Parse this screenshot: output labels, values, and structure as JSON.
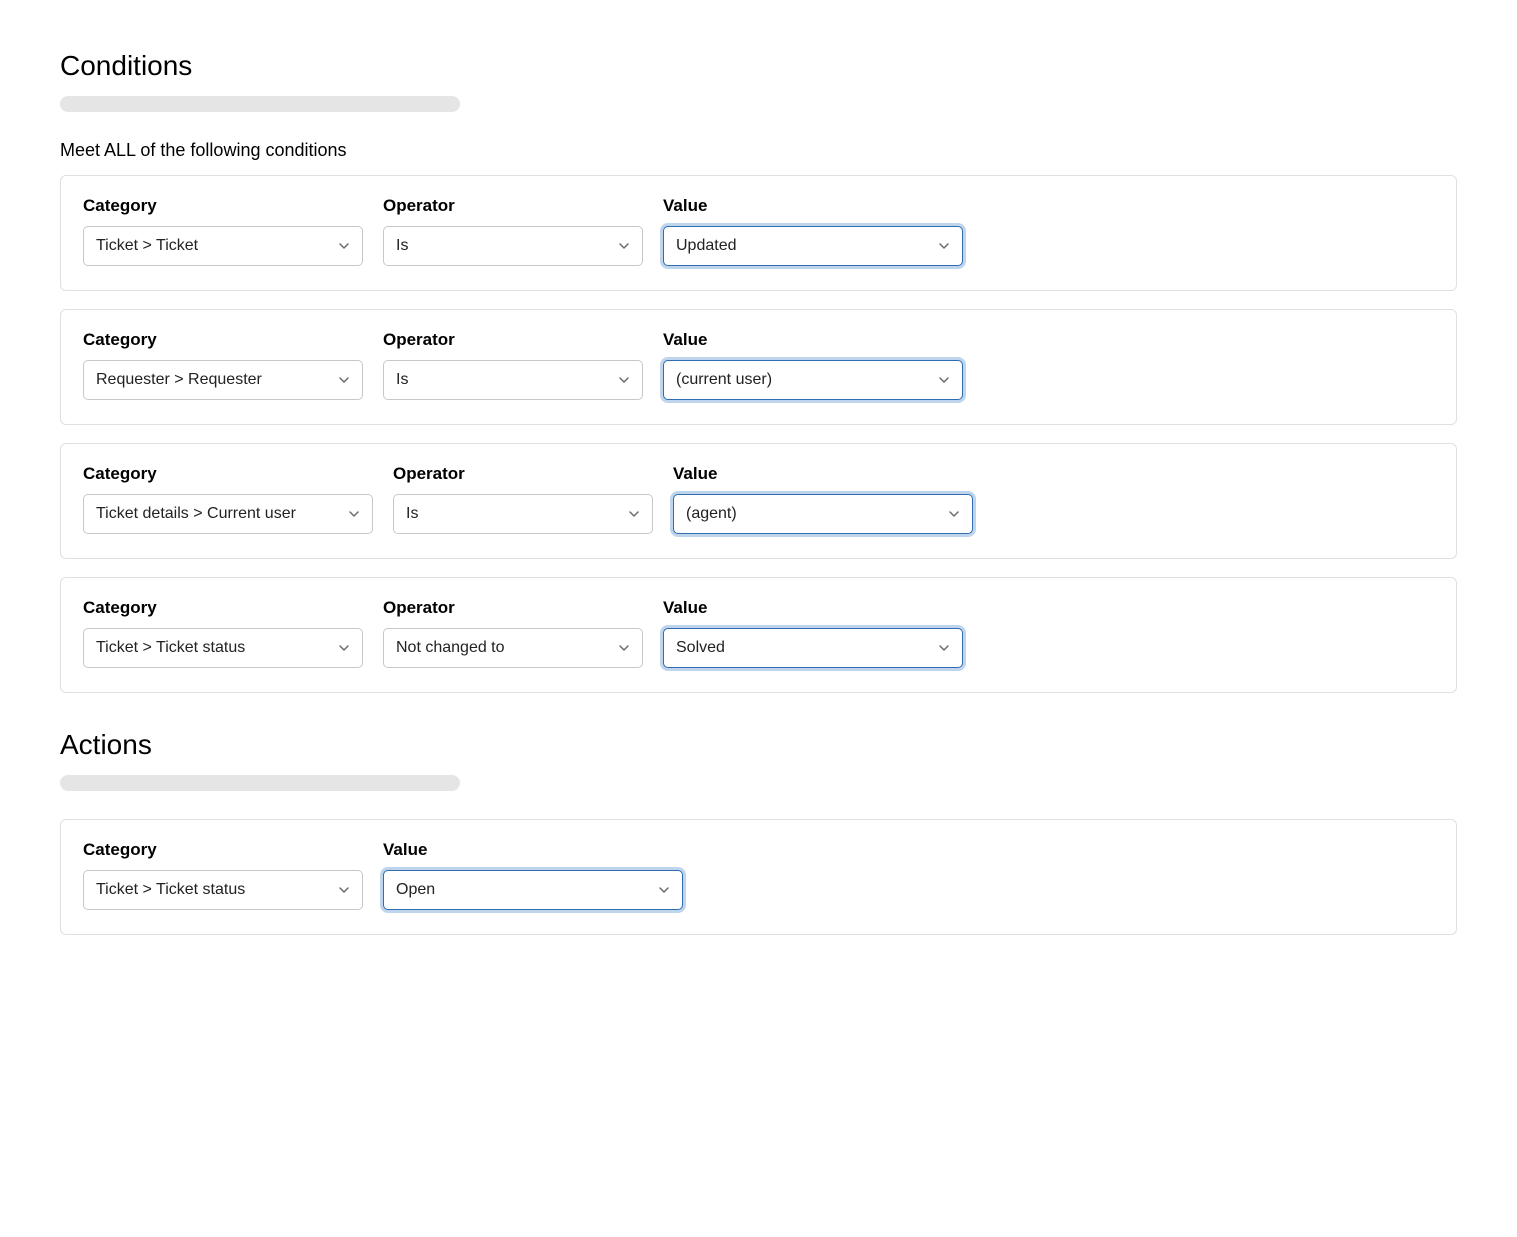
{
  "sections": {
    "conditions": {
      "title": "Conditions",
      "subheading": "Meet ALL of the following conditions",
      "labels": {
        "category": "Category",
        "operator": "Operator",
        "value": "Value"
      },
      "rows": [
        {
          "category": "Ticket > Ticket",
          "operator": "Is",
          "value": "Updated"
        },
        {
          "category": "Requester > Requester",
          "operator": "Is",
          "value": "(current user)"
        },
        {
          "category": "Ticket details > Current user",
          "operator": "Is",
          "value": "(agent)"
        },
        {
          "category": "Ticket > Ticket status",
          "operator": "Not changed to",
          "value": "Solved"
        }
      ]
    },
    "actions": {
      "title": "Actions",
      "labels": {
        "category": "Category",
        "value": "Value"
      },
      "rows": [
        {
          "category": "Ticket > Ticket status",
          "value": "Open"
        }
      ]
    }
  }
}
